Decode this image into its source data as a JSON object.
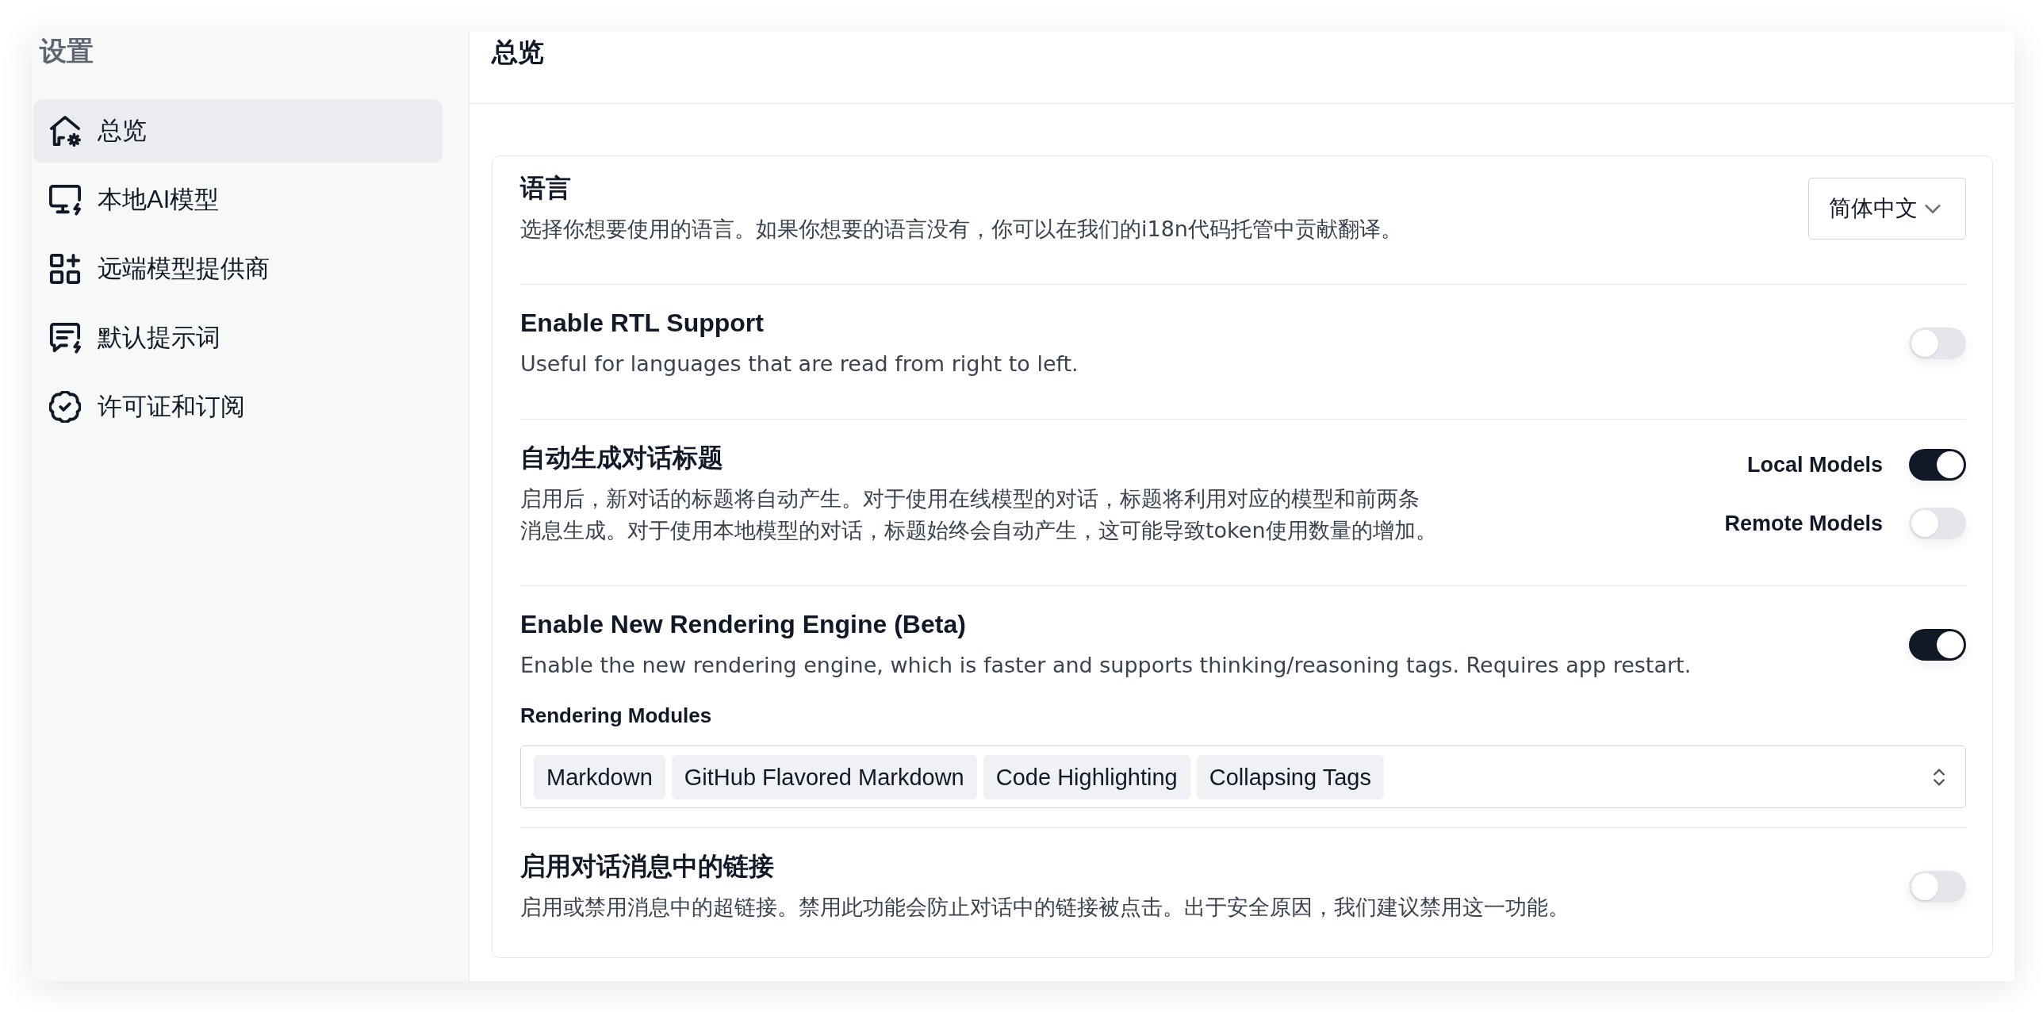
{
  "sidebar": {
    "title": "设置",
    "items": [
      {
        "label": "总览",
        "selected": true
      },
      {
        "label": "本地AI模型",
        "selected": false
      },
      {
        "label": "远端模型提供商",
        "selected": false
      },
      {
        "label": "默认提示词",
        "selected": false
      },
      {
        "label": "许可证和订阅",
        "selected": false
      }
    ]
  },
  "main": {
    "title": "总览",
    "settings": [
      {
        "kind": "select",
        "title": "语言",
        "description": "选择你想要使用的语言。如果你想要的语言没有，你可以在我们的i18n代码托管中贡献翻译。",
        "value": "简体中文"
      },
      {
        "kind": "toggle",
        "title": "Enable RTL Support",
        "description": "Useful for languages that are read from right to left.",
        "on": false
      },
      {
        "kind": "toggle_group",
        "title": "自动生成对话标题",
        "description": "启用后，新对话的标题将自动产生。对于使用在线模型的对话，标题将利用对应的模型和前两条消息生成。对于使用本地模型的对话，标题始终会自动产生，这可能导致token使用数量的增加。",
        "toggles": [
          {
            "label": "Local Models",
            "on": true
          },
          {
            "label": "Remote Models",
            "on": false
          }
        ]
      },
      {
        "kind": "toggle",
        "title": "Enable New Rendering Engine (Beta)",
        "description": "Enable the new rendering engine, which is faster and supports thinking/reasoning tags. Requires app restart.",
        "on": true,
        "modules": {
          "label": "Rendering Modules",
          "tags": [
            "Markdown",
            "GitHub Flavored Markdown",
            "Code Highlighting",
            "Collapsing Tags"
          ]
        }
      },
      {
        "kind": "toggle",
        "title": "启用对话消息中的链接",
        "description": "启用或禁用消息中的超链接。禁用此功能会防止对话中的链接被点击。出于安全原因，我们建议禁用这一功能。",
        "on": false
      }
    ]
  }
}
